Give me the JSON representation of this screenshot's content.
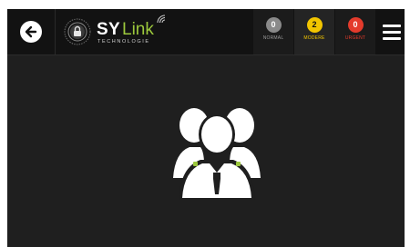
{
  "header": {
    "logo": {
      "brand_bold": "SY",
      "brand_light": "Link",
      "tagline": "TECHNOLOGIE"
    },
    "statuses": [
      {
        "count": "0",
        "label": "NORMAL",
        "color": "#8a8a8a",
        "label_color": "#9a9a9a"
      },
      {
        "count": "2",
        "label": "MODERE",
        "color": "#f2c500",
        "label_color": "#f2c500"
      },
      {
        "count": "0",
        "label": "URGENT",
        "color": "#e43b2c",
        "label_color": "#e43b2c"
      }
    ]
  },
  "icons": {
    "back": "arrow-left-icon",
    "menu": "hamburger-menu-icon",
    "hero": "group-users-icon"
  },
  "colors": {
    "background": "#1f1f1f",
    "topbar": "#121212",
    "accent": "#9cc83c"
  }
}
